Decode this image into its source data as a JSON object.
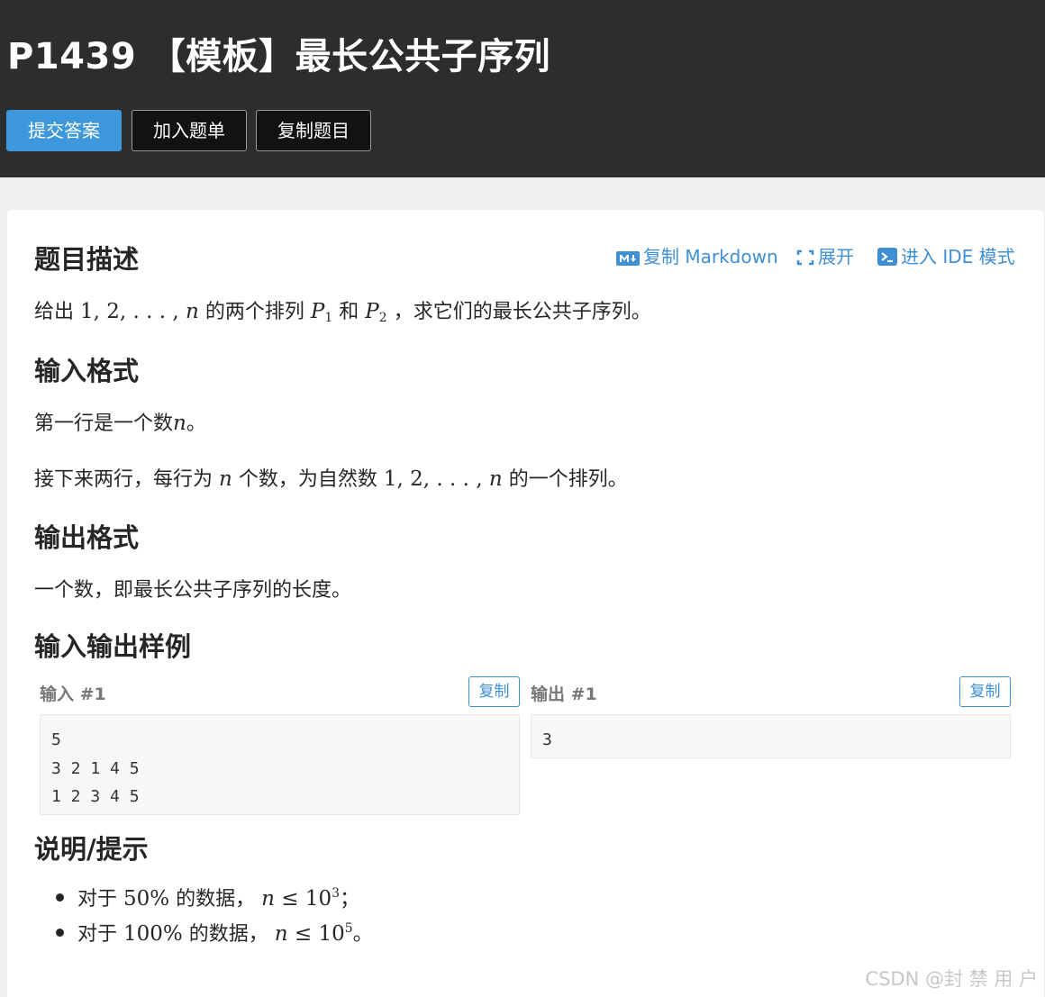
{
  "header": {
    "title": "P1439 【模板】最长公共子序列",
    "buttons": {
      "submit": "提交答案",
      "add_list": "加入题单",
      "copy_problem": "复制题目"
    }
  },
  "actions": {
    "copy_markdown": "复制 Markdown",
    "expand": "展开",
    "ide_mode": "进入 IDE 模式"
  },
  "description": {
    "heading": "题目描述",
    "text_pre": "给出",
    "text_mid1": "的两个排列",
    "text_mid2": "和",
    "text_post": "，求它们的最长公共子序列。"
  },
  "input_format": {
    "heading": "输入格式",
    "line1_pre": "第一行是一个数",
    "line1_post": "。",
    "line2_pre": "接下来两行，每行为",
    "line2_mid": "个数，为自然数",
    "line2_post": "的一个排列。"
  },
  "output_format": {
    "heading": "输出格式",
    "text": "一个数，即最长公共子序列的长度。"
  },
  "samples": {
    "heading": "输入输出样例",
    "input_label": "输入 #1",
    "output_label": "输出 #1",
    "copy_label": "复制",
    "input_text": "5\n3 2 1 4 5\n1 2 3 4 5",
    "output_text": "3"
  },
  "hint": {
    "heading": "说明/提示",
    "item1_pre": "对于",
    "item1_pct": "50%",
    "item1_mid": "的数据，",
    "item1_exp": "3",
    "item1_post": "；",
    "item2_pre": "对于",
    "item2_pct": "100%",
    "item2_mid": "的数据，",
    "item2_exp": "5",
    "item2_post": "。"
  },
  "watermark": "CSDN @封 禁 用 户"
}
